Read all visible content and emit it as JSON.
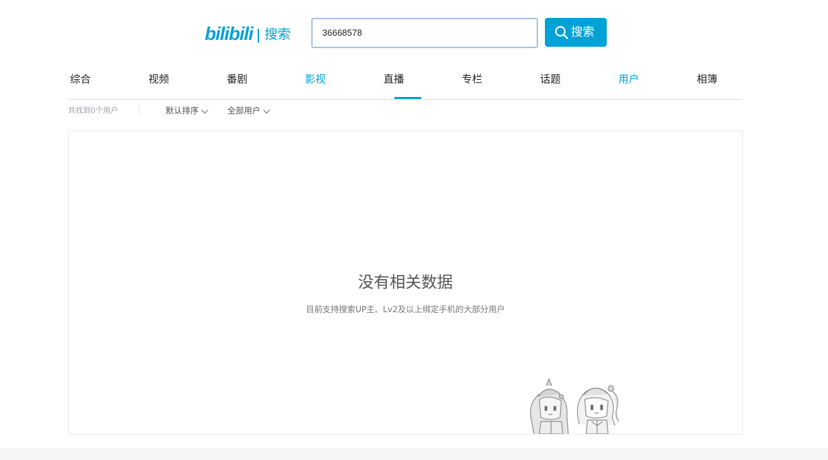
{
  "header": {
    "logo_text": "bilibili",
    "logo_subtitle": "搜索",
    "search": {
      "value": "36668578"
    },
    "search_button_label": "搜索"
  },
  "tabs": [
    {
      "label": "综合"
    },
    {
      "label": "视频"
    },
    {
      "label": "番剧"
    },
    {
      "label": "影视"
    },
    {
      "label": "直播"
    },
    {
      "label": "专栏"
    },
    {
      "label": "话题"
    },
    {
      "label": "用户"
    },
    {
      "label": "相簿"
    }
  ],
  "filters": {
    "result_count": "共找到0个用户",
    "sort": "默认排序",
    "user_type": "全部用户"
  },
  "empty_state": {
    "title": "没有相关数据",
    "description": "目前支持搜索UP主、Lv2及以上绑定手机的大部分用户"
  },
  "colors": {
    "accent": "#00a1d6",
    "search_border": "#a5bfe6",
    "muted_text": "#99a2aa"
  }
}
